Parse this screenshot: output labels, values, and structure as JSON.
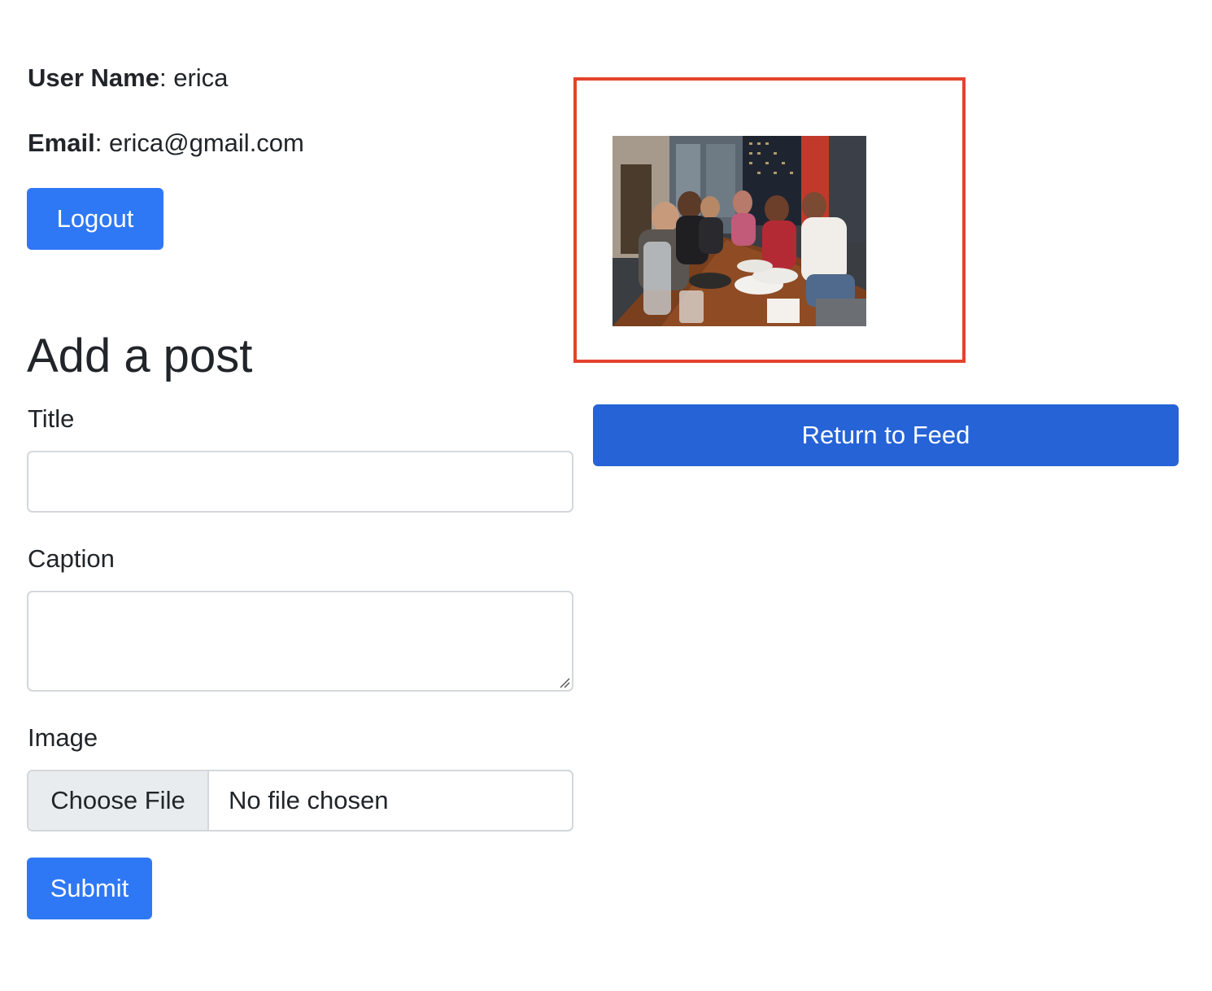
{
  "profile": {
    "username_label": "User Name",
    "username_value": "erica",
    "email_label": "Email",
    "email_value": "erica@gmail.com",
    "logout_label": "Logout"
  },
  "form": {
    "heading": "Add a post",
    "title_label": "Title",
    "title_value": "",
    "caption_label": "Caption",
    "caption_value": "",
    "image_label": "Image",
    "choose_file_label": "Choose File",
    "file_status": "No file chosen",
    "submit_label": "Submit"
  },
  "feed": {
    "return_label": "Return to Feed"
  },
  "colors": {
    "primary": "#2f78f5",
    "feed_button": "#2563d6",
    "highlight": "#e4432d"
  }
}
